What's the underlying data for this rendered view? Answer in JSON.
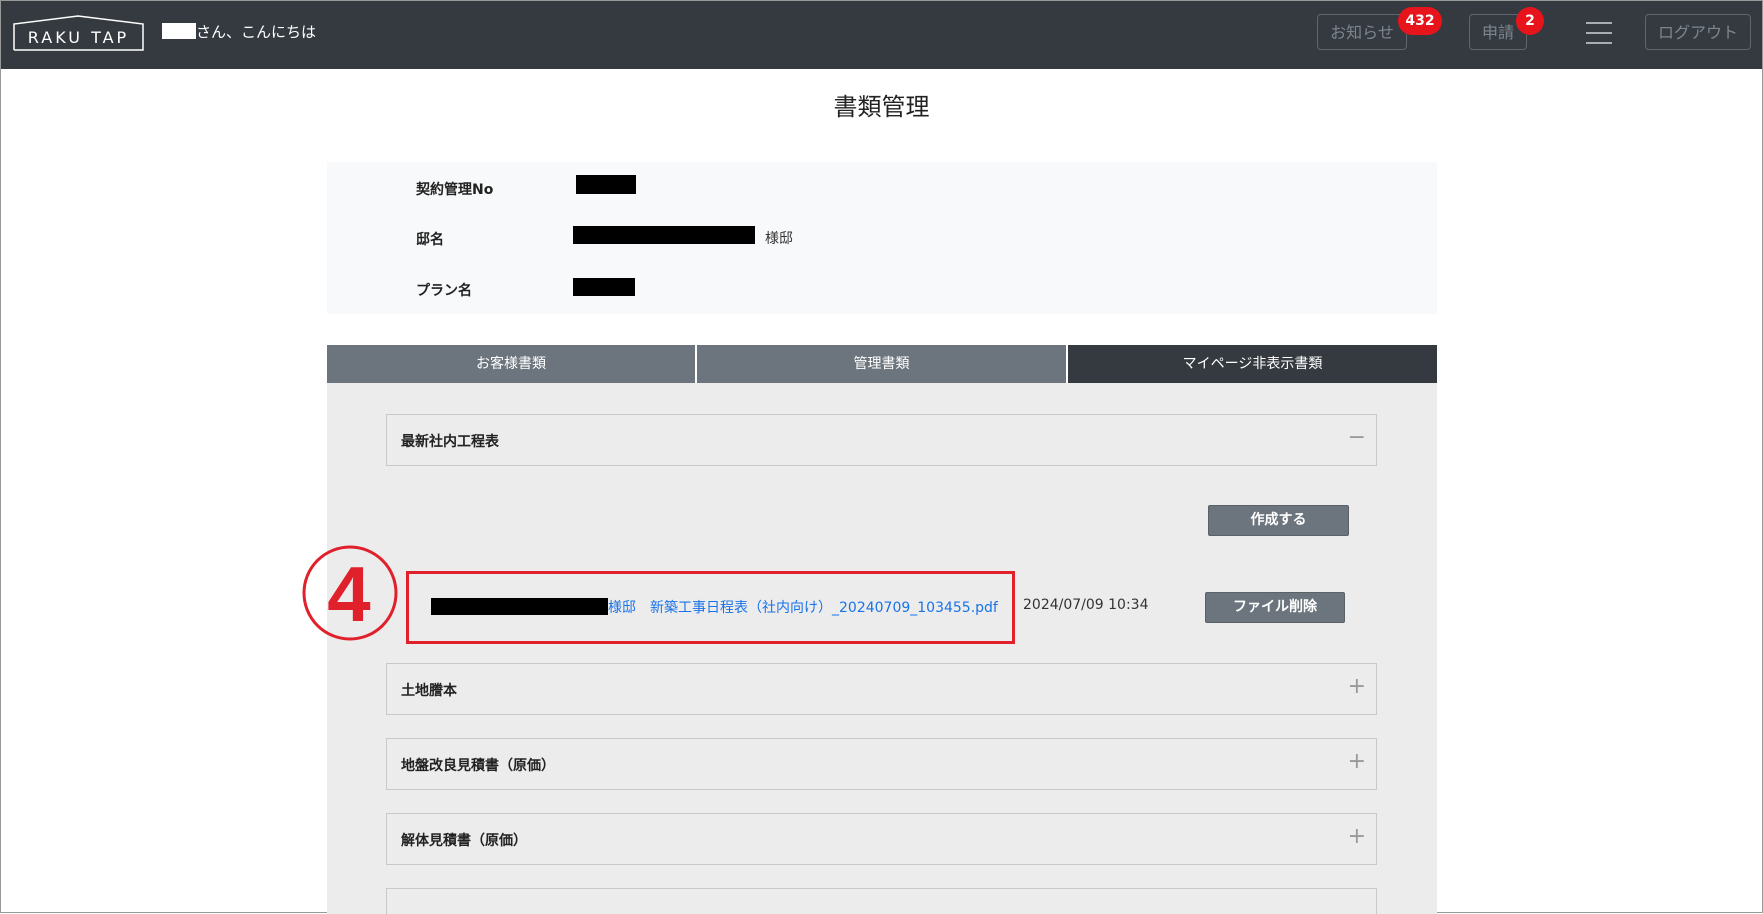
{
  "header": {
    "logo_text": "RAKU TAP",
    "greeting": "さん、こんにちは",
    "notice_label": "お知らせ",
    "notice_count": "432",
    "request_label": "申請",
    "request_count": "2",
    "logout_label": "ログアウト"
  },
  "page_title": "書類管理",
  "info": {
    "contract_no_label": "契約管理No",
    "residence_label": "邸名",
    "residence_suffix": "様邸",
    "plan_label": "プラン名"
  },
  "tabs": [
    {
      "label": "お客様書類",
      "active": false
    },
    {
      "label": "管理書類",
      "active": false
    },
    {
      "label": "マイページ非表示書類",
      "active": true
    }
  ],
  "sections": [
    {
      "title": "最新社内工程表",
      "toggle": "−",
      "expanded": true
    },
    {
      "title": "土地謄本",
      "toggle": "+"
    },
    {
      "title": "地盤改良見積書（原価）",
      "toggle": "+"
    },
    {
      "title": "解体見積書（原価）",
      "toggle": "+"
    }
  ],
  "create_button": "作成する",
  "file": {
    "name": "様邸　新築工事日程表（社内向け）_20240709_103455.pdf",
    "date": "2024/07/09 10:34",
    "delete_button": "ファイル削除"
  },
  "annotation": {
    "step_number": "4",
    "color": "#e0202a"
  }
}
